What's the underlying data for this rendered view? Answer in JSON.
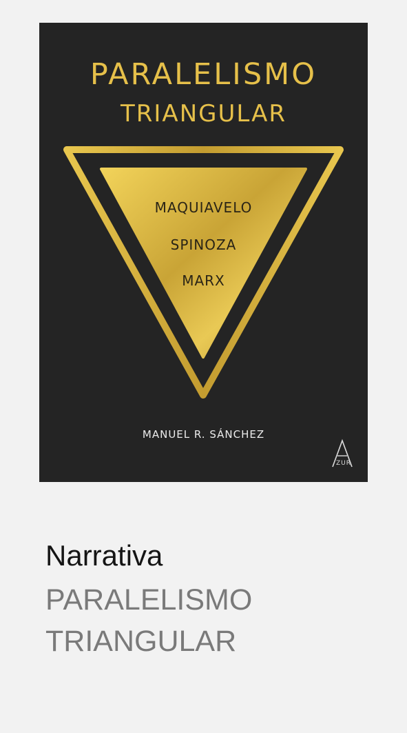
{
  "cover": {
    "title_line1": "PARALELISMO",
    "title_line2": "TRIANGULAR",
    "names": [
      "MAQUIAVELO",
      "SPINOZA",
      "MARX"
    ],
    "author": "MANUEL R. SÁNCHEZ",
    "publisher": "ZUR",
    "background_color": "#242424",
    "accent_color": "#e6c04a"
  },
  "info": {
    "category": "Narrativa",
    "title_line1": "PARALELISMO",
    "title_line2": "TRIANGULAR"
  }
}
